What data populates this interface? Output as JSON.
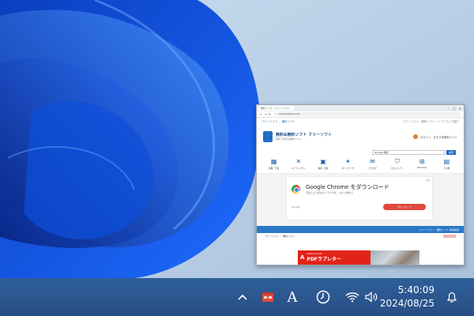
{
  "thumbnail": {
    "tab_title": "無料ソフト・フリーソフト",
    "url": "www.gigafree.net",
    "breadcrumbs": [
      "フリーソフト",
      "無料ソフト"
    ],
    "header_right": "フリーソフト・無料ソフト・ソフトウェア紹介",
    "logo_title": "無料&無料ソフト フリーソフト",
    "logo_sub": "便利で安全な無料ソフト",
    "user_name": "ログイン",
    "user_action": "おすすめ無料ソフト",
    "search_value": "Google 検索",
    "search_button": "検索",
    "categories": [
      {
        "label": "画像・写真",
        "glyph": "▦"
      },
      {
        "label": "ユーティリティ",
        "glyph": "✕"
      },
      {
        "label": "動画・音楽",
        "glyph": "▣"
      },
      {
        "label": "ネットワーク",
        "glyph": "✶"
      },
      {
        "label": "ブラウザ",
        "glyph": "✉"
      },
      {
        "label": "セキュリティ",
        "glyph": "⛉"
      },
      {
        "label": "Windows",
        "glyph": "⊞"
      },
      {
        "label": "その他",
        "glyph": "▤"
      }
    ],
    "ad": {
      "title": "Google Chrome をダウンロード",
      "desc": "高速でより安全なブラウザを、今すぐ無料で",
      "brand": "Google",
      "button": "ダウンロード",
      "mark": "広告"
    },
    "bluebar_text": "フリーソフト ・ 無料ソフト 新着情報",
    "list_row": "フリーソフト ・ 無料ソフト",
    "bottom_ad": {
      "logo": "A",
      "small": "Adobe Acrobat",
      "big": "PDFラプレター"
    }
  },
  "taskbar": {
    "chevron_icon": "chevron-up-icon",
    "ime_label": "A",
    "time": "5:40:09",
    "date": "2024/08/25"
  }
}
